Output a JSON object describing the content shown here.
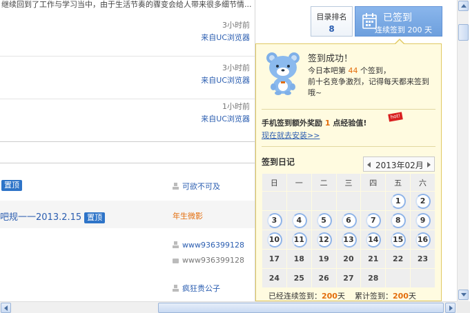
{
  "thread": {
    "truncated_post": "继续回到了工作与学习当中，由于生活节奏的骤变会给人带来很多细节情...",
    "replies": [
      {
        "time": "3小时前",
        "source": "来自UC浏览器"
      },
      {
        "time": "3小时前",
        "source": "来自UC浏览器"
      },
      {
        "time": "1小时前",
        "source": "来自UC浏览器"
      }
    ],
    "topics": [
      {
        "title": "",
        "tag": "置顶",
        "author": "可欲不可及",
        "author2": ""
      },
      {
        "title": "吧规一一2013.2.15",
        "tag": "置顶",
        "author": "年生微影",
        "author2": ""
      },
      {
        "title": "",
        "tag": "",
        "author": "www936399128",
        "author2": "www936399128"
      },
      {
        "title": "",
        "tag": "",
        "author": "疯狂贵公子",
        "author2": ""
      }
    ]
  },
  "sign": {
    "rank_label": "目录排名",
    "rank_value": "8",
    "signed_label": "已签到",
    "streak_text": "连续签到 200 天"
  },
  "popup": {
    "title": "签到成功！",
    "line1_prefix": "今日本吧第",
    "line1_num": "44",
    "line1_suffix": "个签到，",
    "line2": "前十名竞争激烈，记得每天都来签到",
    "line3": "哦~",
    "mobile_prefix": "手机签到额外奖励",
    "mobile_num": "1",
    "mobile_suffix": "点经验值!",
    "hot_badge": "hot!",
    "install_link": "现在就去安装>>",
    "diary_title": "签到日记",
    "month": "2013年02月",
    "weekdays": [
      "日",
      "一",
      "二",
      "三",
      "四",
      "五",
      "六"
    ],
    "weeks": [
      [
        "",
        "",
        "",
        "",
        "",
        "1",
        "2"
      ],
      [
        "3",
        "4",
        "5",
        "6",
        "7",
        "8",
        "9"
      ],
      [
        "10",
        "11",
        "12",
        "13",
        "14",
        "15",
        "16"
      ],
      [
        "17",
        "18",
        "19",
        "20",
        "21",
        "22",
        "23"
      ],
      [
        "24",
        "25",
        "26",
        "27",
        "28",
        "",
        ""
      ]
    ],
    "signed_days": [
      "1",
      "2",
      "3",
      "4",
      "5",
      "6",
      "7",
      "8",
      "9",
      "10",
      "11",
      "12",
      "13",
      "14",
      "15",
      "16"
    ],
    "streak_label": "已经连续签到：",
    "streak_num": "200",
    "streak_unit": "天",
    "total_label": "累计签到：",
    "total_num": "200",
    "total_unit": "天"
  },
  "colors": {
    "link": "#2a5db0",
    "accent_orange": "#e36d0c",
    "signed_blue": "#6d9fdd",
    "popup_bg": "#fffbe0"
  },
  "icons": {
    "calendar": "calendar-icon",
    "bear": "bear-mascot-icon",
    "person": "person-icon",
    "comment": "comment-icon"
  }
}
